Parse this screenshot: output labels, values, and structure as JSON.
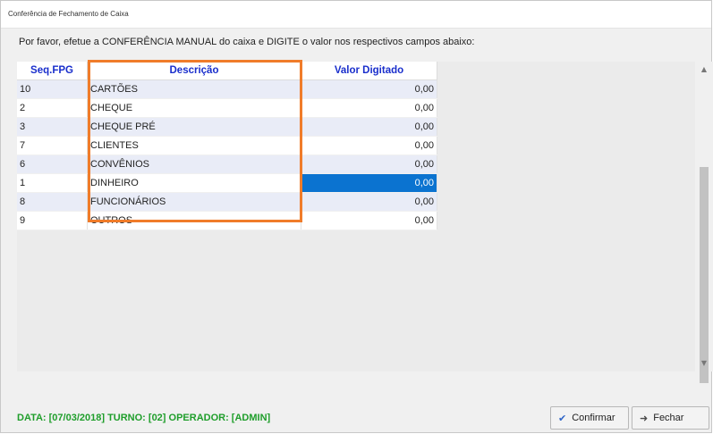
{
  "window": {
    "title": "Conferência de Fechamento de Caixa"
  },
  "instruction": "Por favor, efetue a CONFERÊNCIA MANUAL do caixa e DIGITE o valor nos respectivos campos abaixo:",
  "grid": {
    "columns": [
      "Seq.FPG",
      "Descrição",
      "Valor Digitado"
    ],
    "rows": [
      {
        "seq": "10",
        "desc": "CARTÕES",
        "value": "0,00"
      },
      {
        "seq": "2",
        "desc": "CHEQUE",
        "value": "0,00"
      },
      {
        "seq": "3",
        "desc": "CHEQUE PRÉ",
        "value": "0,00"
      },
      {
        "seq": "7",
        "desc": "CLIENTES",
        "value": "0,00"
      },
      {
        "seq": "6",
        "desc": "CONVÊNIOS",
        "value": "0,00"
      },
      {
        "seq": "1",
        "desc": "DINHEIRO",
        "value": "0,00"
      },
      {
        "seq": "8",
        "desc": "FUNCIONÁRIOS",
        "value": "0,00"
      },
      {
        "seq": "9",
        "desc": "OUTROS",
        "value": "0,00"
      }
    ],
    "selected_row": 5
  },
  "status": "DATA: [07/03/2018]  TURNO: [02]  OPERADOR: [ADMIN]",
  "buttons": {
    "confirm_label": "Confirmar",
    "close_label": "Fechar"
  },
  "icons": {
    "confirm": "confirm-icon",
    "close": "exit-icon",
    "scroll_up": "chevron-up-icon",
    "scroll_down": "chevron-down-icon"
  },
  "colors": {
    "header_text": "#1a2fcc",
    "status_text": "#1f9e2b",
    "selection": "#0b73d0",
    "highlight": "#f07c2a"
  }
}
